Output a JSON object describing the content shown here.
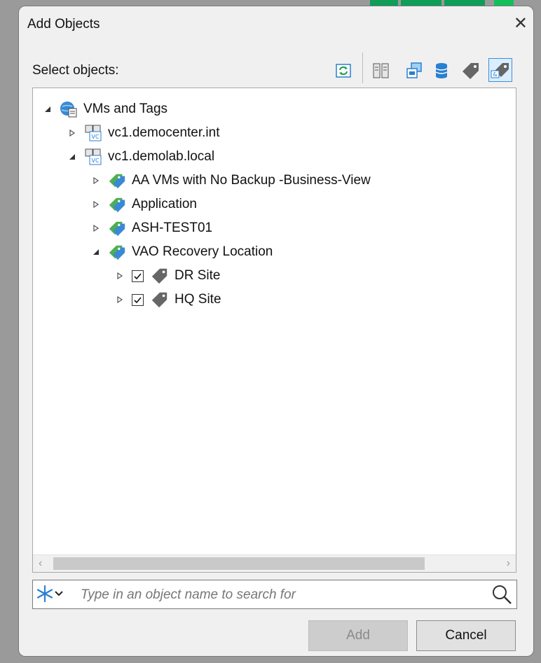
{
  "dialog": {
    "title": "Add Objects",
    "select_label": "Select objects:"
  },
  "toolbar": {
    "items": [
      {
        "icon": "refresh-icon"
      },
      {
        "icon": "hosts-and-clusters-icon"
      },
      {
        "icon": "vms-and-templates-icon"
      },
      {
        "icon": "datastores-icon"
      },
      {
        "icon": "tags-icon"
      },
      {
        "icon": "vms-and-tags-icon",
        "active": true
      }
    ]
  },
  "tree": {
    "root": "VMs and Tags",
    "vcenter1": "vc1.democenter.int",
    "vcenter2": "vc1.demolab.local",
    "category1": "AA VMs with No Backup -Business-View",
    "category2": "Application",
    "category3": "ASH-TEST01",
    "category4": "VAO Recovery Location",
    "tag1": "DR Site",
    "tag2": "HQ Site"
  },
  "search": {
    "placeholder": "Type in an object name to search for",
    "value": ""
  },
  "buttons": {
    "add": "Add",
    "cancel": "Cancel"
  },
  "colors": {
    "accent": "#0f9d58",
    "tag_green": "#4caf50",
    "selection_blue": "#3c8fd6"
  }
}
